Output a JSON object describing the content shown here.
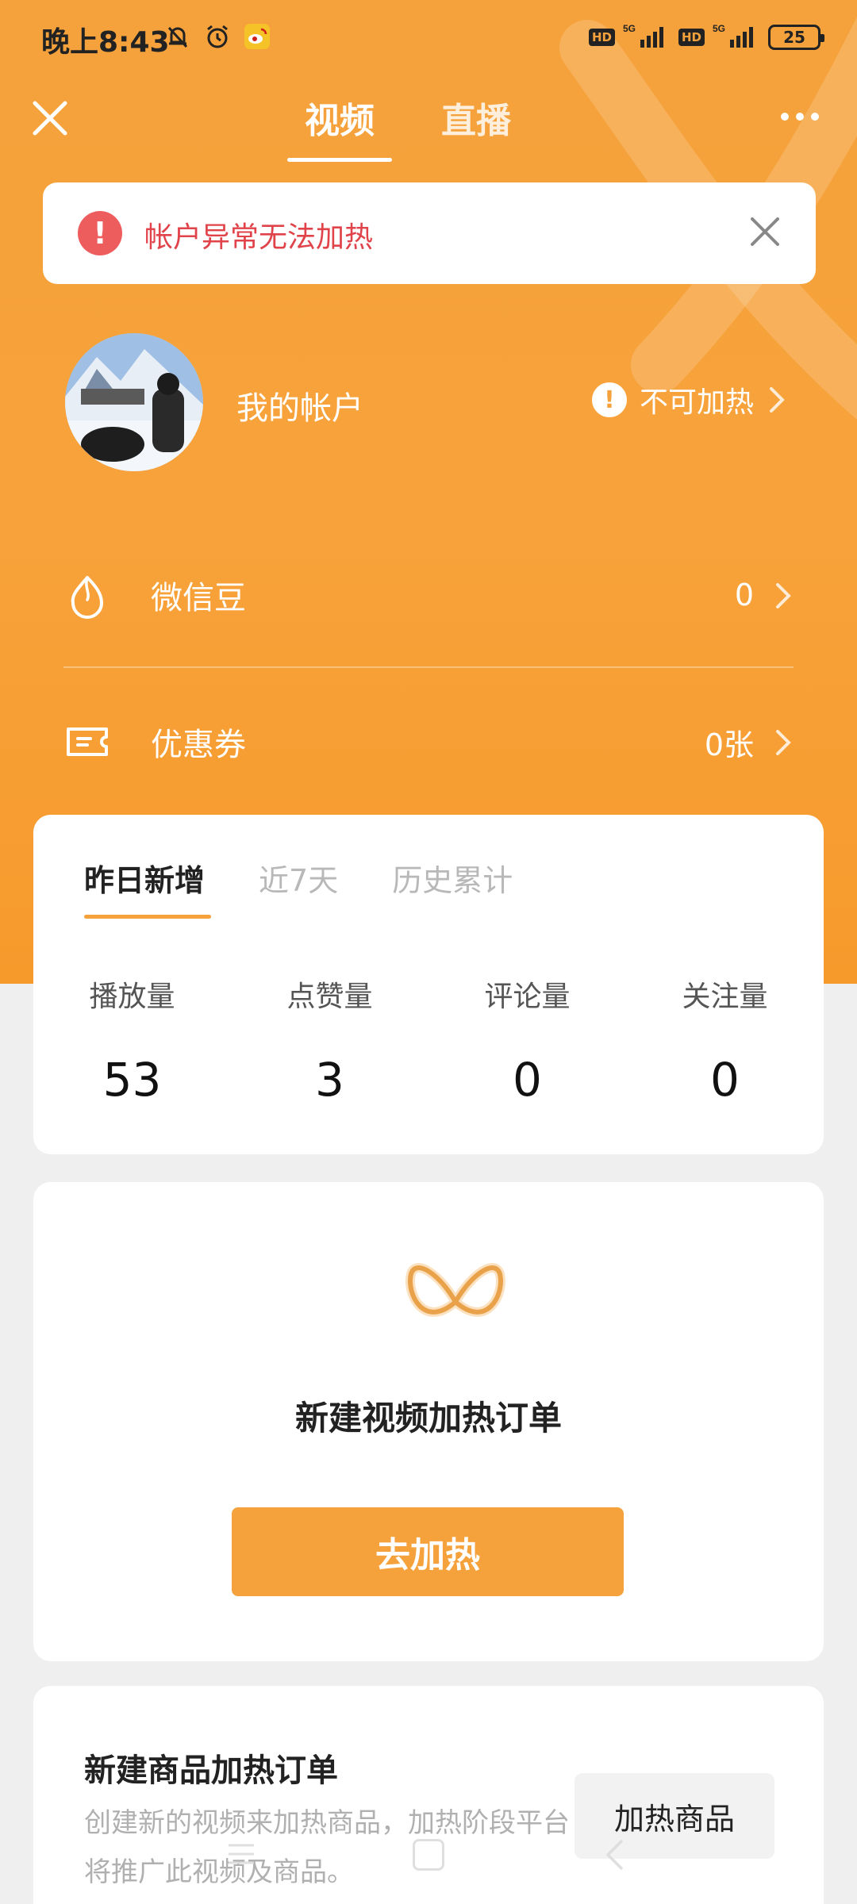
{
  "statusbar": {
    "time": "晚上8:43",
    "icons": [
      "bell-off-icon",
      "alarm-icon",
      "weibo-icon"
    ],
    "hd1": "HD",
    "net1": "5G",
    "hd2": "HD",
    "net2": "5G",
    "battery": "25"
  },
  "topnav": {
    "tabs": [
      {
        "label": "视频",
        "active": true
      },
      {
        "label": "直播",
        "active": false
      }
    ]
  },
  "alert": {
    "text": "帐户异常无法加热",
    "color": "#e0434a"
  },
  "account": {
    "label": "我的帐户",
    "status": "不可加热"
  },
  "rows": [
    {
      "label": "微信豆",
      "value": "0"
    },
    {
      "label": "优惠券",
      "value": "0张"
    }
  ],
  "stats": {
    "tabs": [
      {
        "label": "昨日新增",
        "active": true
      },
      {
        "label": "近7天",
        "active": false
      },
      {
        "label": "历史累计",
        "active": false
      }
    ],
    "items": [
      {
        "name": "播放量",
        "value": "53"
      },
      {
        "name": "点赞量",
        "value": "3"
      },
      {
        "name": "评论量",
        "value": "0"
      },
      {
        "name": "关注量",
        "value": "0"
      }
    ]
  },
  "create": {
    "title": "新建视频加热订单",
    "button": "去加热"
  },
  "product": {
    "title": "新建商品加热订单",
    "desc": "创建新的视频来加热商品，加热阶段平台将推广此视频及商品。",
    "button": "加热商品"
  },
  "colors": {
    "accent": "#f6a23c",
    "error": "#ee5d5d"
  }
}
